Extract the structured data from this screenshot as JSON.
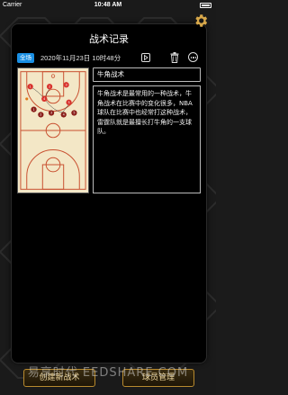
{
  "status_bar": {
    "carrier": "Carrier ⁠",
    "time": "10:48 AM"
  },
  "header": {
    "title": "战术记录"
  },
  "record": {
    "badge": "全场",
    "date": "2020年11月23日 10时48分",
    "tactic_name": "牛角战术",
    "description": "牛角战术是最常用的一种战术，牛角战术在比赛中的变化很多，NBA球队在比赛中也经常打这种战术，雷霆队就是最擅长打牛角的一支球队。"
  },
  "buttons": {
    "create": "创建新战术",
    "players": "球员管理"
  },
  "watermark": "易享时代 EEDSHARE.COM",
  "colors": {
    "accent": "#1a8fe3",
    "gold": "#d8a84a",
    "court": "#f3e7c6",
    "court_line": "#c84f2f",
    "player_red": "#d8312c",
    "player_dark": "#8a1e1a"
  }
}
